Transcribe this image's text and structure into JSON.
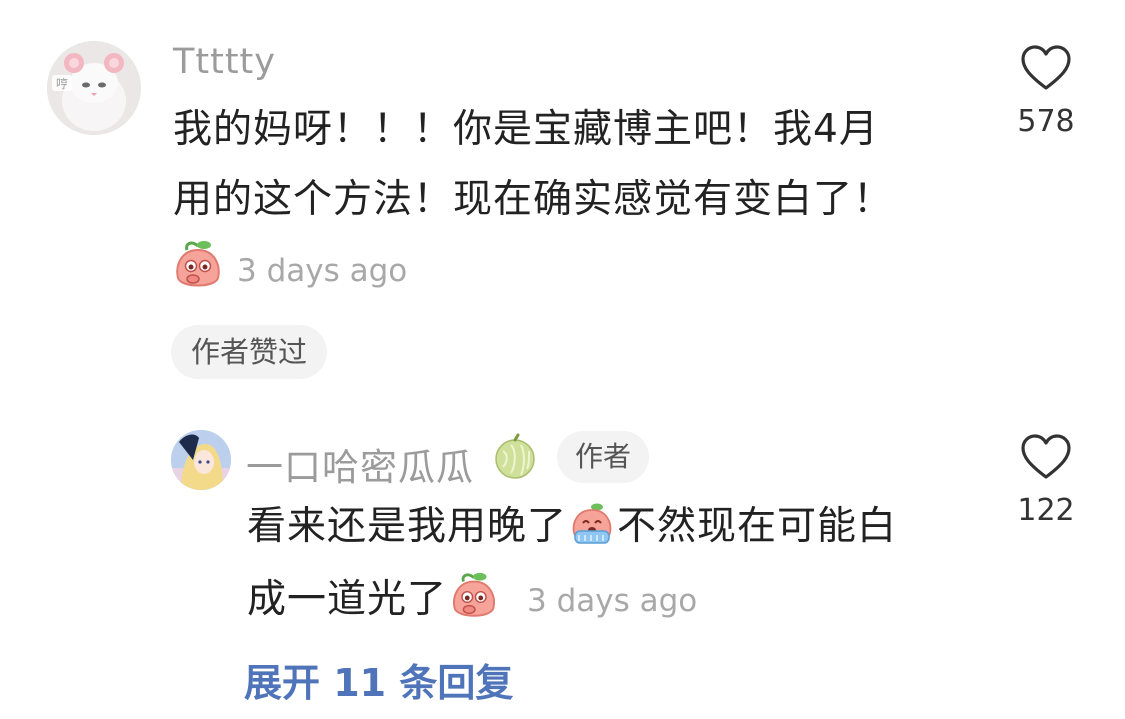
{
  "comment": {
    "username": "Ttttty",
    "text_line1": "我的妈呀！！！你是宝藏博主吧！我4月",
    "text_line2": "用的这个方法！现在确实感觉有变白了！",
    "time": "3 days ago",
    "like_count": "578",
    "author_liked_label": "作者赞过",
    "avatar_icon": "cat-avatar"
  },
  "reply": {
    "username": "一口哈密瓜瓜",
    "author_label": "作者",
    "text_line1_a": "看来还是我用晚了",
    "text_line1_b": "不然现在可能白",
    "text_line2": "成一道光了",
    "time": "3 days ago",
    "like_count": "122",
    "avatar_icon": "anime-avatar"
  },
  "expand_replies_label": "展开 11 条回复",
  "colors": {
    "username": "#9b9b9b",
    "link": "#4f74b9",
    "badge_bg": "#f3f3f3",
    "peach": "#f6a39a"
  }
}
